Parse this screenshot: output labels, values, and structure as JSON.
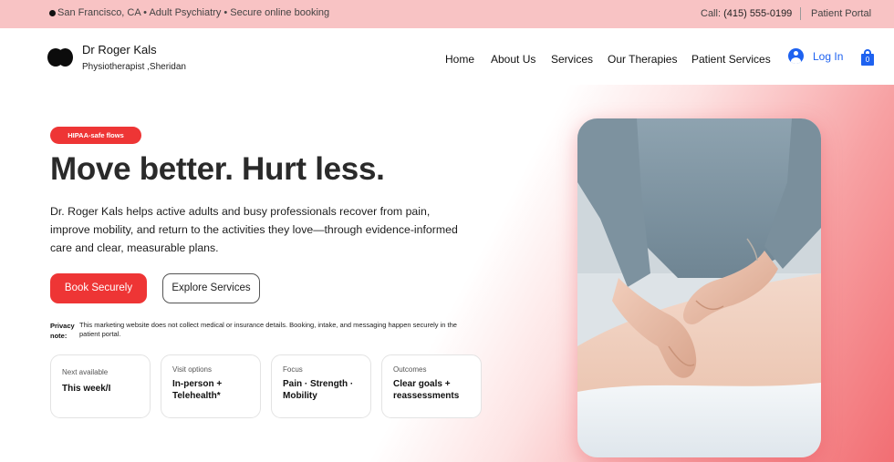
{
  "topbar": {
    "location_text": "San Francisco, CA • Adult Psychiatry • Secure online booking",
    "call_label": "Call:",
    "phone": "(415) 555-0199",
    "portal_link": "Patient Portal"
  },
  "header": {
    "brand_name": "Dr Roger Kals",
    "brand_subtitle": "Physiotherapist ,Sheridan",
    "nav": [
      "Home",
      "About Us",
      "Services",
      "Our Therapies",
      "Patient Services"
    ],
    "login_label": "Log In",
    "cart_count": "0"
  },
  "hero": {
    "badge": "HIPAA-safe flows",
    "headline": "Move better. Hurt less.",
    "intro": "Dr. Roger Kals helps active adults and busy professionals recover from pain, improve mobility, and return to the activities they love—through evidence-informed care and clear, measurable plans.",
    "primary_button": "Book Securely",
    "secondary_button": "Explore Services",
    "privacy_label": "Privacy note:",
    "privacy_text": "This marketing website does not collect medical or insurance details. Booking, intake, and messaging happen securely in the patient portal."
  },
  "cards": [
    {
      "label": "Next available",
      "value": "This week/I"
    },
    {
      "label": "Visit options",
      "value": "In-person + Telehealth*"
    },
    {
      "label": "Focus",
      "value": "Pain · Strength · Mobility"
    },
    {
      "label": "Outcomes",
      "value": "Clear goals + reassessments"
    }
  ],
  "colors": {
    "accent": "#ee3535",
    "link_blue": "#1e62f0",
    "topbar_bg": "#f8c3c4"
  },
  "icons": [
    "brand-logo-icon",
    "user-icon",
    "shopping-bag-icon"
  ]
}
